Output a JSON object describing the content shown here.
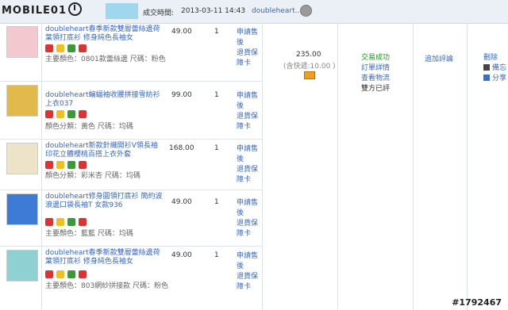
{
  "header": {
    "logo_text": "MOBILE01",
    "time_label": "成交時間:",
    "time_value": "2013-03-11 14:43",
    "seller": "doubleheart...",
    "seller_icon": "wangwang-icon"
  },
  "items": [
    {
      "title": "doubleheart春季新款雙層蕾絲邊荷葉領打底衫 修身純色長袖女",
      "attr": "主要顏色：0801款蕾絲邊 尺碼：粉色",
      "price": "49.00",
      "qty": "1",
      "svc1": "申請售後",
      "svc2": "退貨保障卡",
      "thumb_color": "#f3c9cf"
    },
    {
      "title": "doubleheart蝙蝠袖收腰拼接雪紡衫上衣037",
      "attr": "顏色分類：黃色 尺碼：均碼",
      "price": "99.00",
      "qty": "1",
      "svc1": "申請售後",
      "svc2": "退貨保障卡",
      "thumb_color": "#e2b94b"
    },
    {
      "title": "doubleheart新款針織開衫V領長袖印花立體櫻桃百搭上衣外套",
      "attr": "顏色分類：彩米杏 尺碼：均碼",
      "price": "168.00",
      "qty": "1",
      "svc1": "申請售後",
      "svc2": "退貨保障卡",
      "thumb_color": "#ede3c8"
    },
    {
      "title": "doubleheart修身圓領打底衫 簡約波浪邊口袋長袖T 女款936",
      "attr": "主要顏色：藍藍 尺碼：均碼",
      "price": "49.00",
      "qty": "1",
      "svc1": "申請售後",
      "svc2": "退貨保障卡",
      "thumb_color": "#3e7bd6"
    },
    {
      "title": "doubleheart春季新款雙層蕾絲邊荷葉領打底衫 修身純色長袖女",
      "attr": "主要顏色：803網紗拼接款 尺碼：粉色",
      "price": "49.00",
      "qty": "1",
      "svc1": "申請售後",
      "svc2": "退貨保障卡",
      "thumb_color": "#8fd0d2"
    }
  ],
  "order": {
    "total": "235.00",
    "shipping": "(含快遞:10.00 )",
    "status_1": "交易成功",
    "status_2": "訂單詳情",
    "status_3": "查看物流",
    "status_4": "雙方已評",
    "review": "追加評論",
    "remark_1": "刪除",
    "remark_2": "備忘",
    "remark_3": "分享"
  },
  "watermark": "#1792467",
  "icon_colors": [
    "#d33",
    "#f0c020",
    "#3a9a3a",
    "#d33"
  ]
}
